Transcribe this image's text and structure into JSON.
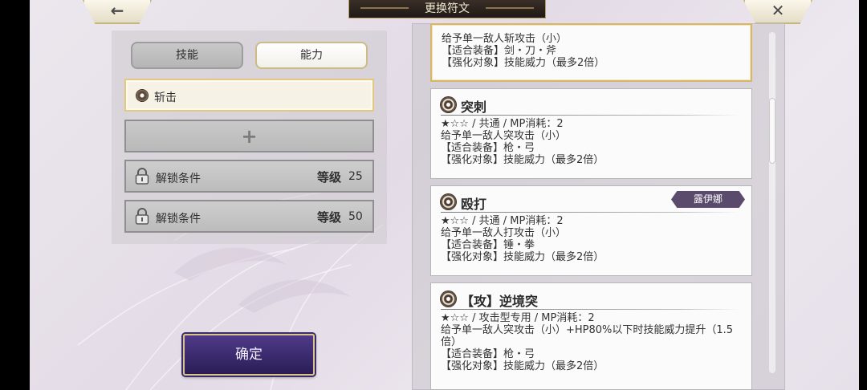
{
  "header": {
    "title": "更换符文",
    "back_glyph": "←",
    "close_glyph": "✕"
  },
  "tabs": [
    {
      "label": "技能",
      "active": false
    },
    {
      "label": "能力",
      "active": true
    }
  ],
  "slots": {
    "equipped": {
      "label": "斩击",
      "icon": "rune-icon"
    },
    "empty": {
      "glyph": "+"
    },
    "locked": [
      {
        "label": "解锁条件",
        "level_label": "等级",
        "level": "25"
      },
      {
        "label": "解锁条件",
        "level_label": "等级",
        "level": "50"
      }
    ]
  },
  "confirm_label": "确定",
  "cards": [
    {
      "name": "",
      "lines": [
        "给予单一敌人斩攻击（小）",
        "【适合装备】剑・刀・斧",
        "【强化对象】技能威力（最多2倍）"
      ]
    },
    {
      "name": "突刺",
      "stars": "★☆☆",
      "meta": " / 共通 / MP消耗：2",
      "lines": [
        "给予单一敌人突攻击（小）",
        "【适合装备】枪・弓",
        "【强化对象】技能威力（最多2倍）"
      ]
    },
    {
      "name": "殴打",
      "badge": "露伊娜",
      "stars": "★☆☆",
      "meta": " / 共通 / MP消耗：2",
      "lines": [
        "给予单一敌人打攻击（小）",
        "【适合装备】锤・拳",
        "【强化对象】技能威力（最多2倍）"
      ]
    },
    {
      "name": "【攻】逆境突",
      "stars": "★☆☆",
      "meta": " / 攻击型专用 / MP消耗：2",
      "lines": [
        "给予单一敌人突攻击（小）+HP80%以下时技能威力提升（1.5倍）",
        "【适合装备】枪・弓",
        "【强化对象】技能威力（最多2倍）"
      ]
    }
  ],
  "colors": {
    "accent_gold": "#d6b769",
    "confirm_purple": "#3b2b6b",
    "badge_purple": "#5a4a6c"
  }
}
